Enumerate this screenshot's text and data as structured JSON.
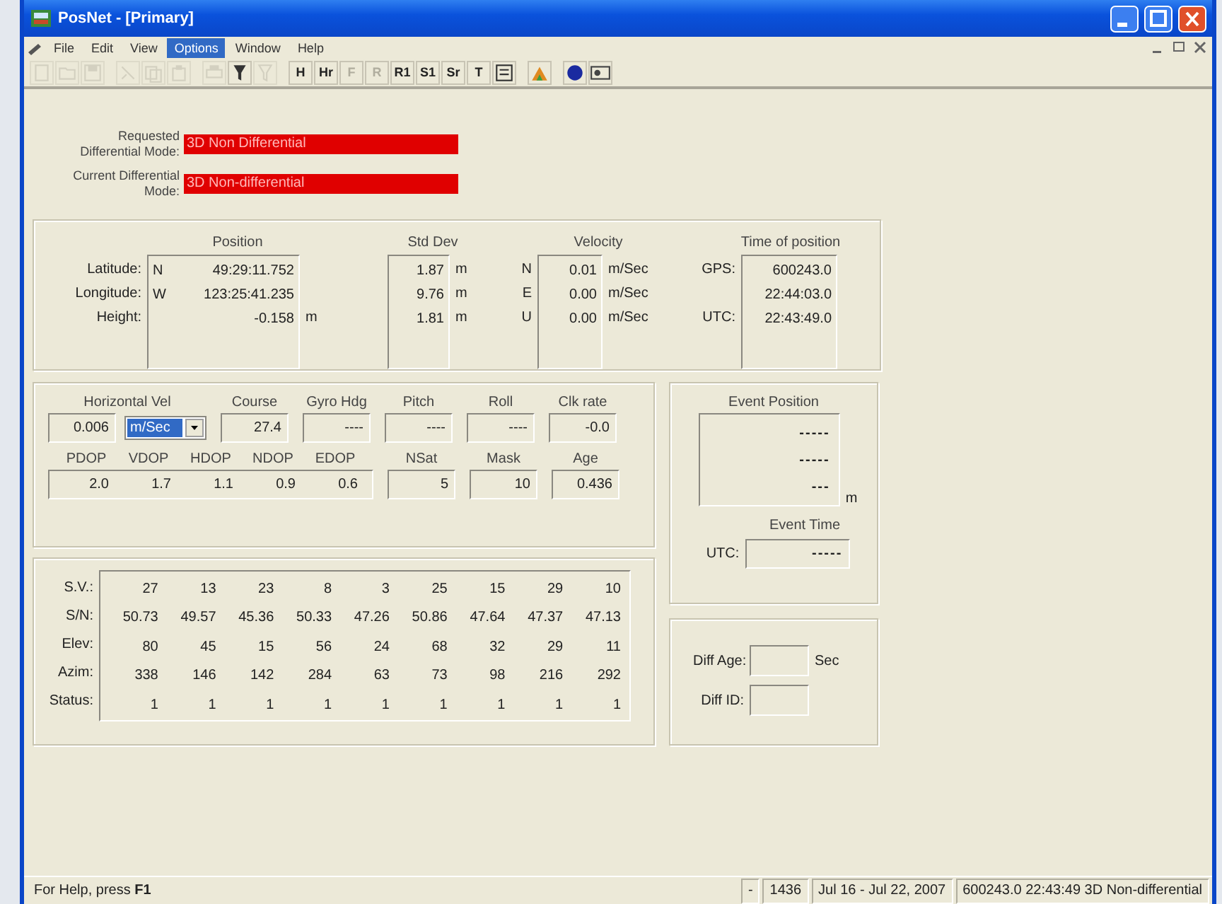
{
  "window": {
    "title": "PosNet - [Primary]"
  },
  "menu": [
    {
      "label": "File",
      "selected": false
    },
    {
      "label": "Edit",
      "selected": false
    },
    {
      "label": "View",
      "selected": false
    },
    {
      "label": "Options",
      "selected": true
    },
    {
      "label": "Window",
      "selected": false
    },
    {
      "label": "Help",
      "selected": false
    }
  ],
  "toolbar": [
    {
      "kind": "icon",
      "disabled": true
    },
    {
      "kind": "icon",
      "disabled": true
    },
    {
      "kind": "icon",
      "disabled": true
    },
    {
      "kind": "sep"
    },
    {
      "kind": "icon",
      "disabled": true
    },
    {
      "kind": "icon",
      "disabled": true
    },
    {
      "kind": "icon",
      "disabled": true
    },
    {
      "kind": "sep"
    },
    {
      "kind": "icon",
      "disabled": true
    },
    {
      "kind": "icon",
      "disabled": false
    },
    {
      "kind": "icon",
      "disabled": true
    },
    {
      "kind": "sep"
    },
    {
      "kind": "text",
      "label": "H",
      "disabled": false
    },
    {
      "kind": "text",
      "label": "Hr",
      "disabled": false
    },
    {
      "kind": "text",
      "label": "F",
      "disabled": true
    },
    {
      "kind": "text",
      "label": "R",
      "disabled": true
    },
    {
      "kind": "text",
      "label": "R1",
      "disabled": false
    },
    {
      "kind": "text",
      "label": "S1",
      "disabled": false
    },
    {
      "kind": "text",
      "label": "Sr",
      "disabled": false
    },
    {
      "kind": "text",
      "label": "T",
      "disabled": false
    },
    {
      "kind": "icon",
      "disabled": false
    },
    {
      "kind": "sep"
    },
    {
      "kind": "icon",
      "disabled": false
    },
    {
      "kind": "sep"
    },
    {
      "kind": "icon",
      "disabled": false
    },
    {
      "kind": "icon",
      "disabled": false
    }
  ],
  "modes": [
    {
      "label": "Requested Differential Mode:",
      "value": "3D Non Differential"
    },
    {
      "label": "Current Differential Mode:",
      "value": "3D Non-differential"
    }
  ],
  "position": {
    "title": "Position",
    "rows": [
      {
        "label": "Latitude:",
        "hemisphere": "N",
        "value": "49:29:11.752"
      },
      {
        "label": "Longitude:",
        "hemisphere": "W",
        "value": "123:25:41.235"
      },
      {
        "label": "Height:",
        "value": "-0.158",
        "unit": "m"
      }
    ]
  },
  "std_dev": {
    "title": "Std Dev",
    "rows": [
      {
        "value": "1.87",
        "unit": "m"
      },
      {
        "value": "9.76",
        "unit": "m"
      },
      {
        "value": "1.81",
        "unit": "m"
      }
    ]
  },
  "velocity": {
    "title": "Velocity",
    "rows": [
      {
        "axis": "N",
        "value": "0.01",
        "unit": "m/Sec"
      },
      {
        "axis": "E",
        "value": "0.00",
        "unit": "m/Sec"
      },
      {
        "axis": "U",
        "value": "0.00",
        "unit": "m/Sec"
      }
    ]
  },
  "time_of_position": {
    "title": "Time of position",
    "rows": [
      {
        "label": "GPS:",
        "value": "600243.0"
      },
      {
        "value": "22:44:03.0"
      },
      {
        "label": "UTC:",
        "value": "22:43:49.0"
      }
    ]
  },
  "motion": {
    "horizontal_vel": {
      "title": "Horizontal Vel",
      "value": "0.006",
      "unit": "m/Sec",
      "unit_focused": true
    },
    "fields": [
      {
        "title": "Course",
        "value": "27.4"
      },
      {
        "title": "Gyro Hdg",
        "value": "----"
      },
      {
        "title": "Pitch",
        "value": "----"
      },
      {
        "title": "Roll",
        "value": "----"
      },
      {
        "title": "Clk rate",
        "value": "-0.0"
      }
    ],
    "dops": [
      {
        "title": "PDOP",
        "value": "2.0"
      },
      {
        "title": "VDOP",
        "value": "1.7"
      },
      {
        "title": "HDOP",
        "value": "1.1"
      },
      {
        "title": "NDOP",
        "value": "0.9"
      },
      {
        "title": "EDOP",
        "value": "0.6"
      }
    ],
    "extras": [
      {
        "title": "NSat",
        "value": "5"
      },
      {
        "title": "Mask",
        "value": "10"
      },
      {
        "title": "Age",
        "value": "0.436"
      }
    ]
  },
  "satellites": {
    "rows": [
      {
        "label": "S.V.:",
        "values": [
          "27",
          "13",
          "23",
          "8",
          "3",
          "25",
          "15",
          "29",
          "10"
        ]
      },
      {
        "label": "S/N:",
        "values": [
          "50.73",
          "49.57",
          "45.36",
          "50.33",
          "47.26",
          "50.86",
          "47.64",
          "47.37",
          "47.13"
        ]
      },
      {
        "label": "Elev:",
        "values": [
          "80",
          "45",
          "15",
          "56",
          "24",
          "68",
          "32",
          "29",
          "11"
        ]
      },
      {
        "label": "Azim:",
        "values": [
          "338",
          "146",
          "142",
          "284",
          "63",
          "73",
          "98",
          "216",
          "292"
        ]
      },
      {
        "label": "Status:",
        "values": [
          "1",
          "1",
          "1",
          "1",
          "1",
          "1",
          "1",
          "1",
          "1"
        ]
      }
    ]
  },
  "event": {
    "title": "Event Position",
    "values": [
      "-----",
      "-----",
      "---"
    ],
    "unit": "m",
    "time_title": "Event Time",
    "time_label": "UTC:",
    "time_value": "-----"
  },
  "diff": {
    "age_label": "Diff Age:",
    "age_unit": "Sec",
    "id_label": "Diff ID:"
  },
  "status_bar": {
    "help": "For Help, press **F1**",
    "panes": [
      "-",
      "1436",
      "Jul 16 - Jul 22, 2007",
      "600243.0  22:43:49  3D Non-differential"
    ]
  }
}
